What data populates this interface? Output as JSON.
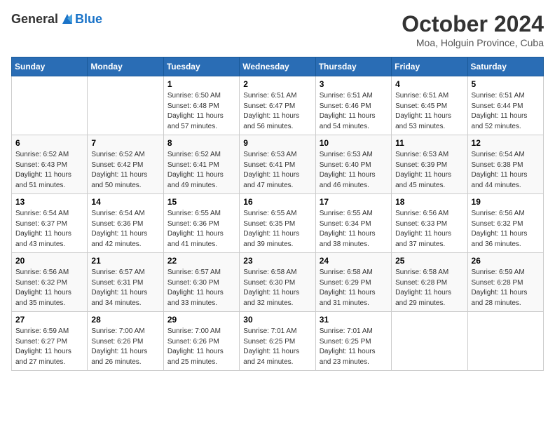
{
  "header": {
    "logo_general": "General",
    "logo_blue": "Blue",
    "month_title": "October 2024",
    "location": "Moa, Holguin Province, Cuba"
  },
  "days_of_week": [
    "Sunday",
    "Monday",
    "Tuesday",
    "Wednesday",
    "Thursday",
    "Friday",
    "Saturday"
  ],
  "weeks": [
    [
      {
        "day": "",
        "info": ""
      },
      {
        "day": "",
        "info": ""
      },
      {
        "day": "1",
        "info": "Sunrise: 6:50 AM\nSunset: 6:48 PM\nDaylight: 11 hours and 57 minutes."
      },
      {
        "day": "2",
        "info": "Sunrise: 6:51 AM\nSunset: 6:47 PM\nDaylight: 11 hours and 56 minutes."
      },
      {
        "day": "3",
        "info": "Sunrise: 6:51 AM\nSunset: 6:46 PM\nDaylight: 11 hours and 54 minutes."
      },
      {
        "day": "4",
        "info": "Sunrise: 6:51 AM\nSunset: 6:45 PM\nDaylight: 11 hours and 53 minutes."
      },
      {
        "day": "5",
        "info": "Sunrise: 6:51 AM\nSunset: 6:44 PM\nDaylight: 11 hours and 52 minutes."
      }
    ],
    [
      {
        "day": "6",
        "info": "Sunrise: 6:52 AM\nSunset: 6:43 PM\nDaylight: 11 hours and 51 minutes."
      },
      {
        "day": "7",
        "info": "Sunrise: 6:52 AM\nSunset: 6:42 PM\nDaylight: 11 hours and 50 minutes."
      },
      {
        "day": "8",
        "info": "Sunrise: 6:52 AM\nSunset: 6:41 PM\nDaylight: 11 hours and 49 minutes."
      },
      {
        "day": "9",
        "info": "Sunrise: 6:53 AM\nSunset: 6:41 PM\nDaylight: 11 hours and 47 minutes."
      },
      {
        "day": "10",
        "info": "Sunrise: 6:53 AM\nSunset: 6:40 PM\nDaylight: 11 hours and 46 minutes."
      },
      {
        "day": "11",
        "info": "Sunrise: 6:53 AM\nSunset: 6:39 PM\nDaylight: 11 hours and 45 minutes."
      },
      {
        "day": "12",
        "info": "Sunrise: 6:54 AM\nSunset: 6:38 PM\nDaylight: 11 hours and 44 minutes."
      }
    ],
    [
      {
        "day": "13",
        "info": "Sunrise: 6:54 AM\nSunset: 6:37 PM\nDaylight: 11 hours and 43 minutes."
      },
      {
        "day": "14",
        "info": "Sunrise: 6:54 AM\nSunset: 6:36 PM\nDaylight: 11 hours and 42 minutes."
      },
      {
        "day": "15",
        "info": "Sunrise: 6:55 AM\nSunset: 6:36 PM\nDaylight: 11 hours and 41 minutes."
      },
      {
        "day": "16",
        "info": "Sunrise: 6:55 AM\nSunset: 6:35 PM\nDaylight: 11 hours and 39 minutes."
      },
      {
        "day": "17",
        "info": "Sunrise: 6:55 AM\nSunset: 6:34 PM\nDaylight: 11 hours and 38 minutes."
      },
      {
        "day": "18",
        "info": "Sunrise: 6:56 AM\nSunset: 6:33 PM\nDaylight: 11 hours and 37 minutes."
      },
      {
        "day": "19",
        "info": "Sunrise: 6:56 AM\nSunset: 6:32 PM\nDaylight: 11 hours and 36 minutes."
      }
    ],
    [
      {
        "day": "20",
        "info": "Sunrise: 6:56 AM\nSunset: 6:32 PM\nDaylight: 11 hours and 35 minutes."
      },
      {
        "day": "21",
        "info": "Sunrise: 6:57 AM\nSunset: 6:31 PM\nDaylight: 11 hours and 34 minutes."
      },
      {
        "day": "22",
        "info": "Sunrise: 6:57 AM\nSunset: 6:30 PM\nDaylight: 11 hours and 33 minutes."
      },
      {
        "day": "23",
        "info": "Sunrise: 6:58 AM\nSunset: 6:30 PM\nDaylight: 11 hours and 32 minutes."
      },
      {
        "day": "24",
        "info": "Sunrise: 6:58 AM\nSunset: 6:29 PM\nDaylight: 11 hours and 31 minutes."
      },
      {
        "day": "25",
        "info": "Sunrise: 6:58 AM\nSunset: 6:28 PM\nDaylight: 11 hours and 29 minutes."
      },
      {
        "day": "26",
        "info": "Sunrise: 6:59 AM\nSunset: 6:28 PM\nDaylight: 11 hours and 28 minutes."
      }
    ],
    [
      {
        "day": "27",
        "info": "Sunrise: 6:59 AM\nSunset: 6:27 PM\nDaylight: 11 hours and 27 minutes."
      },
      {
        "day": "28",
        "info": "Sunrise: 7:00 AM\nSunset: 6:26 PM\nDaylight: 11 hours and 26 minutes."
      },
      {
        "day": "29",
        "info": "Sunrise: 7:00 AM\nSunset: 6:26 PM\nDaylight: 11 hours and 25 minutes."
      },
      {
        "day": "30",
        "info": "Sunrise: 7:01 AM\nSunset: 6:25 PM\nDaylight: 11 hours and 24 minutes."
      },
      {
        "day": "31",
        "info": "Sunrise: 7:01 AM\nSunset: 6:25 PM\nDaylight: 11 hours and 23 minutes."
      },
      {
        "day": "",
        "info": ""
      },
      {
        "day": "",
        "info": ""
      }
    ]
  ]
}
